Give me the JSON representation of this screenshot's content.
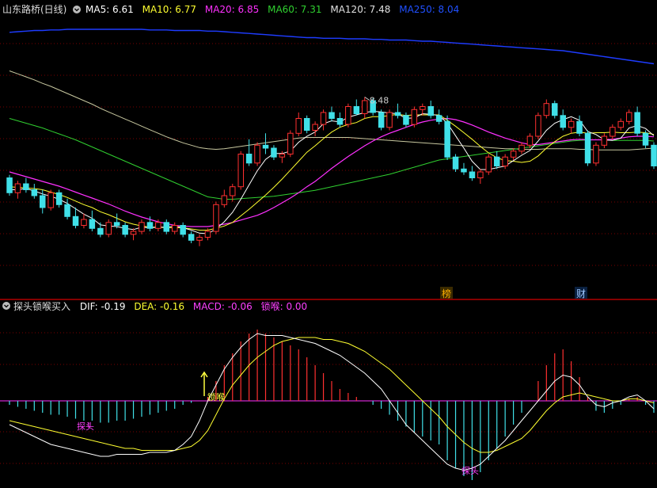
{
  "colors": {
    "background": "#000000",
    "grid": "#7a0000",
    "up": "#ff3030",
    "down": "#40e0e8",
    "ma5": "#ffffff",
    "ma10": "#ffff30",
    "ma20": "#ff30ff",
    "ma60": "#30d030",
    "ma120": "#c8c8a0",
    "ma250": "#1e3cff",
    "dif": "#ffffff",
    "dea": "#ffff30",
    "macd_label": "#ff40ff",
    "signal": "#ff40ff"
  },
  "main_panel": {
    "title": "山东路桥(日线)",
    "legend": [
      {
        "label": "MA5: 6.61",
        "color": "#ffffff"
      },
      {
        "label": "MA10: 6.77",
        "color": "#ffff30"
      },
      {
        "label": "MA20: 6.85",
        "color": "#ff30ff"
      },
      {
        "label": "MA60: 7.31",
        "color": "#30d030"
      },
      {
        "label": "MA120: 7.48",
        "color": "#e0e0e0"
      },
      {
        "label": "MA250: 8.04",
        "color": "#2050ff"
      }
    ],
    "high_label": "8.48",
    "markers": [
      {
        "text": "榜",
        "color": "#ffb000"
      },
      {
        "text": "财",
        "color": "#a0c8ff"
      }
    ]
  },
  "indicator_panel": {
    "title": "探头锁喉买入",
    "legend": [
      {
        "label": "DIF: -0.19",
        "color": "#ffffff"
      },
      {
        "label": "DEA: -0.16",
        "color": "#ffff30"
      },
      {
        "label": "MACD: -0.06",
        "color": "#ff40ff"
      },
      {
        "label": "锁喉: 0.00",
        "color": "#ff40ff"
      }
    ],
    "signals": [
      {
        "text": "探头",
        "color": "#ff40ff"
      },
      {
        "text": "锁喉",
        "color": "#ffff40"
      },
      {
        "text": "探头",
        "color": "#ff40ff"
      }
    ]
  },
  "chart_data": [
    {
      "type": "candlestick",
      "title": "山东路桥(日线)",
      "candles": [
        [
          7.3,
          7.35,
          7.0,
          7.05
        ],
        [
          7.05,
          7.25,
          6.95,
          7.2
        ],
        [
          7.2,
          7.3,
          7.05,
          7.1
        ],
        [
          7.1,
          7.2,
          6.95,
          7.0
        ],
        [
          7.0,
          7.1,
          6.7,
          6.8
        ],
        [
          6.8,
          7.1,
          6.75,
          7.05
        ],
        [
          7.05,
          7.1,
          6.8,
          6.85
        ],
        [
          6.85,
          6.95,
          6.6,
          6.65
        ],
        [
          6.65,
          6.8,
          6.45,
          6.5
        ],
        [
          6.5,
          6.7,
          6.45,
          6.6
        ],
        [
          6.6,
          6.75,
          6.4,
          6.45
        ],
        [
          6.45,
          6.55,
          6.3,
          6.35
        ],
        [
          6.35,
          6.6,
          6.3,
          6.55
        ],
        [
          6.55,
          6.7,
          6.45,
          6.5
        ],
        [
          6.5,
          6.55,
          6.3,
          6.35
        ],
        [
          6.35,
          6.45,
          6.25,
          6.4
        ],
        [
          6.4,
          6.6,
          6.35,
          6.55
        ],
        [
          6.55,
          6.65,
          6.4,
          6.45
        ],
        [
          6.45,
          6.6,
          6.4,
          6.55
        ],
        [
          6.55,
          6.6,
          6.35,
          6.4
        ],
        [
          6.4,
          6.55,
          6.35,
          6.5
        ],
        [
          6.5,
          6.55,
          6.3,
          6.35
        ],
        [
          6.35,
          6.4,
          6.2,
          6.25
        ],
        [
          6.25,
          6.35,
          6.15,
          6.3
        ],
        [
          6.3,
          6.45,
          6.25,
          6.4
        ],
        [
          6.4,
          6.9,
          6.35,
          6.85
        ],
        [
          6.85,
          7.1,
          6.8,
          7.0
        ],
        [
          7.0,
          7.2,
          6.9,
          7.15
        ],
        [
          7.15,
          7.75,
          7.1,
          7.7
        ],
        [
          7.7,
          7.95,
          7.5,
          7.55
        ],
        [
          7.55,
          7.9,
          7.5,
          7.85
        ],
        [
          7.85,
          8.05,
          7.7,
          7.8
        ],
        [
          7.8,
          7.85,
          7.6,
          7.65
        ],
        [
          7.65,
          7.75,
          7.55,
          7.7
        ],
        [
          7.7,
          8.1,
          7.65,
          8.05
        ],
        [
          8.05,
          8.4,
          8.0,
          8.3
        ],
        [
          8.3,
          8.35,
          8.05,
          8.1
        ],
        [
          8.1,
          8.25,
          8.0,
          8.2
        ],
        [
          8.2,
          8.45,
          8.1,
          8.4
        ],
        [
          8.4,
          8.5,
          8.25,
          8.3
        ],
        [
          8.3,
          8.4,
          8.15,
          8.2
        ],
        [
          8.2,
          8.55,
          8.15,
          8.5
        ],
        [
          8.5,
          8.62,
          8.35,
          8.38
        ],
        [
          8.38,
          8.66,
          8.3,
          8.6
        ],
        [
          8.6,
          8.64,
          8.35,
          8.4
        ],
        [
          8.4,
          8.45,
          8.1,
          8.15
        ],
        [
          8.15,
          8.45,
          8.1,
          8.4
        ],
        [
          8.4,
          8.55,
          8.3,
          8.35
        ],
        [
          8.35,
          8.4,
          8.15,
          8.2
        ],
        [
          8.2,
          8.5,
          8.15,
          8.45
        ],
        [
          8.45,
          8.55,
          8.35,
          8.5
        ],
        [
          8.5,
          8.6,
          8.3,
          8.35
        ],
        [
          8.35,
          8.45,
          8.2,
          8.25
        ],
        [
          8.25,
          8.35,
          7.6,
          7.65
        ],
        [
          7.65,
          7.7,
          7.4,
          7.45
        ],
        [
          7.45,
          7.55,
          7.35,
          7.4
        ],
        [
          7.4,
          7.5,
          7.25,
          7.3
        ],
        [
          7.3,
          7.45,
          7.2,
          7.4
        ],
        [
          7.4,
          7.7,
          7.35,
          7.65
        ],
        [
          7.65,
          7.75,
          7.45,
          7.5
        ],
        [
          7.5,
          7.7,
          7.45,
          7.65
        ],
        [
          7.65,
          7.8,
          7.6,
          7.75
        ],
        [
          7.75,
          7.9,
          7.7,
          7.85
        ],
        [
          7.85,
          8.05,
          7.8,
          8.0
        ],
        [
          8.0,
          8.4,
          7.95,
          8.35
        ],
        [
          8.35,
          8.62,
          8.3,
          8.55
        ],
        [
          8.55,
          8.6,
          8.3,
          8.35
        ],
        [
          8.35,
          8.45,
          8.1,
          8.15
        ],
        [
          8.15,
          8.3,
          8.05,
          8.25
        ],
        [
          8.25,
          8.35,
          8.0,
          8.05
        ],
        [
          8.05,
          8.1,
          7.5,
          7.55
        ],
        [
          7.55,
          7.9,
          7.5,
          7.85
        ],
        [
          7.85,
          8.05,
          7.8,
          8.0
        ],
        [
          8.0,
          8.2,
          7.95,
          8.15
        ],
        [
          8.15,
          8.3,
          8.1,
          8.25
        ],
        [
          8.25,
          8.45,
          8.2,
          8.4
        ],
        [
          8.4,
          8.5,
          8.0,
          8.05
        ],
        [
          8.05,
          8.1,
          7.8,
          7.85
        ],
        [
          7.85,
          7.9,
          7.45,
          7.5
        ]
      ],
      "ma_lines": {
        "MA5": [
          7.1,
          7.1,
          7.12,
          7.08,
          7.03,
          6.99,
          6.94,
          6.87,
          6.78,
          6.69,
          6.62,
          6.51,
          6.49,
          6.48,
          6.45,
          6.43,
          6.47,
          6.46,
          6.47,
          6.47,
          6.49,
          6.46,
          6.42,
          6.37,
          6.36,
          6.44,
          6.56,
          6.72,
          6.94,
          7.18,
          7.42,
          7.61,
          7.71,
          7.71,
          7.75,
          7.9,
          8.0,
          8.07,
          8.21,
          8.26,
          8.24,
          8.32,
          8.36,
          8.4,
          8.42,
          8.41,
          8.39,
          8.38,
          8.3,
          8.31,
          8.38,
          8.37,
          8.35,
          8.22,
          8.01,
          7.8,
          7.58,
          7.44,
          7.44,
          7.47,
          7.5,
          7.59,
          7.68,
          7.76,
          7.92,
          8.1,
          8.22,
          8.28,
          8.33,
          8.27,
          8.08,
          8.03,
          7.94,
          7.93,
          7.97,
          8.14,
          8.18,
          8.13,
          8.01
        ],
        "MA10": [
          7.15,
          7.14,
          7.13,
          7.12,
          7.1,
          7.06,
          7.02,
          6.97,
          6.91,
          6.85,
          6.8,
          6.73,
          6.68,
          6.62,
          6.56,
          6.52,
          6.49,
          6.47,
          6.47,
          6.46,
          6.46,
          6.46,
          6.44,
          6.42,
          6.42,
          6.45,
          6.49,
          6.55,
          6.66,
          6.77,
          6.89,
          7.01,
          7.14,
          7.28,
          7.43,
          7.58,
          7.73,
          7.84,
          7.96,
          8.07,
          8.15,
          8.2,
          8.23,
          8.3,
          8.33,
          8.33,
          8.35,
          8.37,
          8.35,
          8.36,
          8.36,
          8.36,
          8.36,
          8.27,
          8.17,
          8.06,
          7.95,
          7.83,
          7.72,
          7.64,
          7.59,
          7.58,
          7.56,
          7.58,
          7.67,
          7.8,
          7.91,
          8.0,
          8.05,
          8.07,
          8.05,
          8.06,
          8.06,
          8.07,
          8.06,
          8.06,
          8.07,
          8.06,
          8.03
        ],
        "MA20": [
          7.4,
          7.36,
          7.32,
          7.28,
          7.24,
          7.2,
          7.16,
          7.11,
          7.06,
          7.01,
          6.96,
          6.91,
          6.86,
          6.8,
          6.74,
          6.69,
          6.64,
          6.6,
          6.56,
          6.53,
          6.5,
          6.49,
          6.48,
          6.48,
          6.48,
          6.5,
          6.52,
          6.55,
          6.59,
          6.63,
          6.67,
          6.73,
          6.8,
          6.88,
          6.96,
          7.05,
          7.15,
          7.24,
          7.35,
          7.46,
          7.56,
          7.66,
          7.75,
          7.84,
          7.92,
          7.99,
          8.05,
          8.1,
          8.15,
          8.2,
          8.24,
          8.27,
          8.29,
          8.3,
          8.28,
          8.24,
          8.19,
          8.13,
          8.07,
          8.02,
          7.97,
          7.93,
          7.89,
          7.86,
          7.86,
          7.88,
          7.9,
          7.92,
          7.94,
          7.95,
          7.94,
          7.94,
          7.94,
          7.95,
          7.97,
          7.99,
          8.0,
          8.0,
          7.99
        ],
        "MA60": [
          8.3,
          8.26,
          8.22,
          8.18,
          8.14,
          8.09,
          8.04,
          7.99,
          7.94,
          7.88,
          7.82,
          7.76,
          7.7,
          7.64,
          7.58,
          7.52,
          7.46,
          7.4,
          7.34,
          7.28,
          7.22,
          7.16,
          7.1,
          7.04,
          6.98,
          6.96,
          6.94,
          6.94,
          6.95,
          6.96,
          6.97,
          6.98,
          6.99,
          7.01,
          7.03,
          7.05,
          7.07,
          7.09,
          7.12,
          7.15,
          7.18,
          7.21,
          7.24,
          7.27,
          7.3,
          7.33,
          7.36,
          7.4,
          7.44,
          7.48,
          7.52,
          7.56,
          7.6,
          7.62,
          7.64,
          7.66,
          7.68,
          7.7,
          7.72,
          7.74,
          7.76,
          7.78,
          7.8,
          7.82,
          7.84,
          7.86,
          7.88,
          7.9,
          7.92,
          7.93,
          7.94,
          7.94,
          7.94,
          7.93,
          7.93,
          7.93,
          7.93,
          7.93,
          7.92
        ],
        "MA120": [
          9.1,
          9.05,
          9.0,
          8.95,
          8.89,
          8.84,
          8.78,
          8.72,
          8.66,
          8.6,
          8.54,
          8.47,
          8.41,
          8.35,
          8.29,
          8.23,
          8.17,
          8.11,
          8.05,
          7.99,
          7.94,
          7.89,
          7.85,
          7.81,
          7.79,
          7.78,
          7.79,
          7.81,
          7.83,
          7.85,
          7.87,
          7.89,
          7.91,
          7.93,
          7.95,
          7.97,
          7.98,
          7.98,
          7.98,
          7.98,
          7.98,
          7.98,
          7.97,
          7.96,
          7.95,
          7.94,
          7.93,
          7.92,
          7.91,
          7.9,
          7.89,
          7.88,
          7.87,
          7.86,
          7.85,
          7.84,
          7.83,
          7.82,
          7.81,
          7.8,
          7.79,
          7.79,
          7.78,
          7.78,
          7.78,
          7.79,
          7.79,
          7.79,
          7.79,
          7.78,
          7.78,
          7.77,
          7.77,
          7.77,
          7.77,
          7.77,
          7.78,
          7.79,
          7.8
        ],
        "MA250": [
          9.75,
          9.76,
          9.77,
          9.78,
          9.78,
          9.79,
          9.79,
          9.8,
          9.8,
          9.8,
          9.8,
          9.8,
          9.8,
          9.8,
          9.8,
          9.8,
          9.8,
          9.79,
          9.79,
          9.79,
          9.78,
          9.78,
          9.78,
          9.78,
          9.77,
          9.77,
          9.76,
          9.75,
          9.74,
          9.73,
          9.72,
          9.71,
          9.7,
          9.69,
          9.68,
          9.67,
          9.66,
          9.66,
          9.65,
          9.65,
          9.65,
          9.64,
          9.64,
          9.64,
          9.63,
          9.63,
          9.62,
          9.62,
          9.62,
          9.61,
          9.6,
          9.6,
          9.59,
          9.58,
          9.57,
          9.56,
          9.55,
          9.54,
          9.53,
          9.52,
          9.51,
          9.5,
          9.49,
          9.48,
          9.47,
          9.46,
          9.45,
          9.44,
          9.42,
          9.4,
          9.38,
          9.36,
          9.34,
          9.32,
          9.3,
          9.28,
          9.26,
          9.24,
          9.22
        ]
      },
      "high_annotation": {
        "index": 43,
        "value": 8.48
      }
    },
    {
      "type": "bar",
      "title": "探头锁喉买入",
      "macd": [
        -0.02,
        -0.03,
        -0.04,
        -0.05,
        -0.06,
        -0.07,
        -0.07,
        -0.08,
        -0.09,
        -0.1,
        -0.1,
        -0.11,
        -0.11,
        -0.1,
        -0.1,
        -0.09,
        -0.08,
        -0.07,
        -0.06,
        -0.05,
        -0.04,
        -0.02,
        -0.01,
        0.0,
        0.02,
        0.1,
        0.18,
        0.24,
        0.3,
        0.34,
        0.36,
        0.34,
        0.32,
        0.3,
        0.28,
        0.26,
        0.22,
        0.18,
        0.14,
        0.1,
        0.06,
        0.04,
        0.02,
        0.0,
        -0.02,
        -0.04,
        -0.07,
        -0.1,
        -0.13,
        -0.16,
        -0.18,
        -0.2,
        -0.22,
        -0.3,
        -0.34,
        -0.38,
        -0.4,
        -0.36,
        -0.3,
        -0.24,
        -0.18,
        -0.12,
        -0.06,
        0.0,
        0.1,
        0.18,
        0.24,
        0.26,
        0.2,
        0.12,
        0.02,
        -0.05,
        -0.06,
        -0.04,
        -0.02,
        0.01,
        0.02,
        -0.02,
        -0.06
      ],
      "dif": [
        -0.12,
        -0.14,
        -0.16,
        -0.18,
        -0.2,
        -0.22,
        -0.23,
        -0.24,
        -0.25,
        -0.26,
        -0.27,
        -0.28,
        -0.28,
        -0.27,
        -0.27,
        -0.27,
        -0.27,
        -0.26,
        -0.26,
        -0.26,
        -0.25,
        -0.22,
        -0.18,
        -0.1,
        0.0,
        0.08,
        0.16,
        0.22,
        0.27,
        0.31,
        0.34,
        0.33,
        0.33,
        0.33,
        0.32,
        0.31,
        0.3,
        0.29,
        0.27,
        0.25,
        0.23,
        0.2,
        0.17,
        0.14,
        0.1,
        0.06,
        0.0,
        -0.06,
        -0.12,
        -0.16,
        -0.2,
        -0.24,
        -0.28,
        -0.32,
        -0.34,
        -0.35,
        -0.34,
        -0.32,
        -0.28,
        -0.24,
        -0.2,
        -0.15,
        -0.1,
        -0.05,
        0.0,
        0.05,
        0.1,
        0.13,
        0.12,
        0.08,
        0.02,
        -0.02,
        -0.03,
        -0.01,
        0.0,
        0.02,
        0.03,
        0.0,
        -0.04
      ],
      "dea": [
        -0.1,
        -0.11,
        -0.12,
        -0.13,
        -0.14,
        -0.15,
        -0.16,
        -0.17,
        -0.18,
        -0.19,
        -0.2,
        -0.21,
        -0.22,
        -0.23,
        -0.24,
        -0.24,
        -0.25,
        -0.25,
        -0.25,
        -0.25,
        -0.25,
        -0.24,
        -0.23,
        -0.2,
        -0.15,
        -0.07,
        0.01,
        0.08,
        0.13,
        0.18,
        0.22,
        0.25,
        0.28,
        0.3,
        0.31,
        0.32,
        0.32,
        0.32,
        0.31,
        0.31,
        0.3,
        0.29,
        0.27,
        0.25,
        0.22,
        0.19,
        0.16,
        0.12,
        0.08,
        0.04,
        0.0,
        -0.04,
        -0.08,
        -0.13,
        -0.17,
        -0.21,
        -0.24,
        -0.26,
        -0.26,
        -0.25,
        -0.23,
        -0.21,
        -0.19,
        -0.15,
        -0.1,
        -0.05,
        -0.01,
        0.02,
        0.03,
        0.04,
        0.03,
        0.02,
        0.01,
        0.0,
        0.0,
        0.01,
        0.01,
        0.0,
        -0.01
      ]
    }
  ]
}
